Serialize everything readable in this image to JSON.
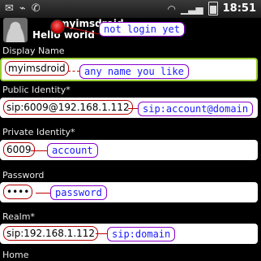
{
  "statusbar": {
    "time": "18:51"
  },
  "header": {
    "app_title": "myimsdroid",
    "subtitle": "Hello world",
    "status_annotation": "not login yet"
  },
  "fields": [
    {
      "label": "Display Name",
      "value": "myimsdroid",
      "annotation": "any name you like"
    },
    {
      "label": "Public Identity*",
      "value": "sip:6009@192.168.1.112",
      "annotation": "sip:account@domain"
    },
    {
      "label": "Private Identity*",
      "value": "6009",
      "annotation": "account"
    },
    {
      "label": "Password",
      "value": "••••",
      "annotation": "password"
    },
    {
      "label": "Realm*",
      "value": "sip:192.168.1.112",
      "annotation": "sip:domain"
    }
  ],
  "footer_label": "Home"
}
